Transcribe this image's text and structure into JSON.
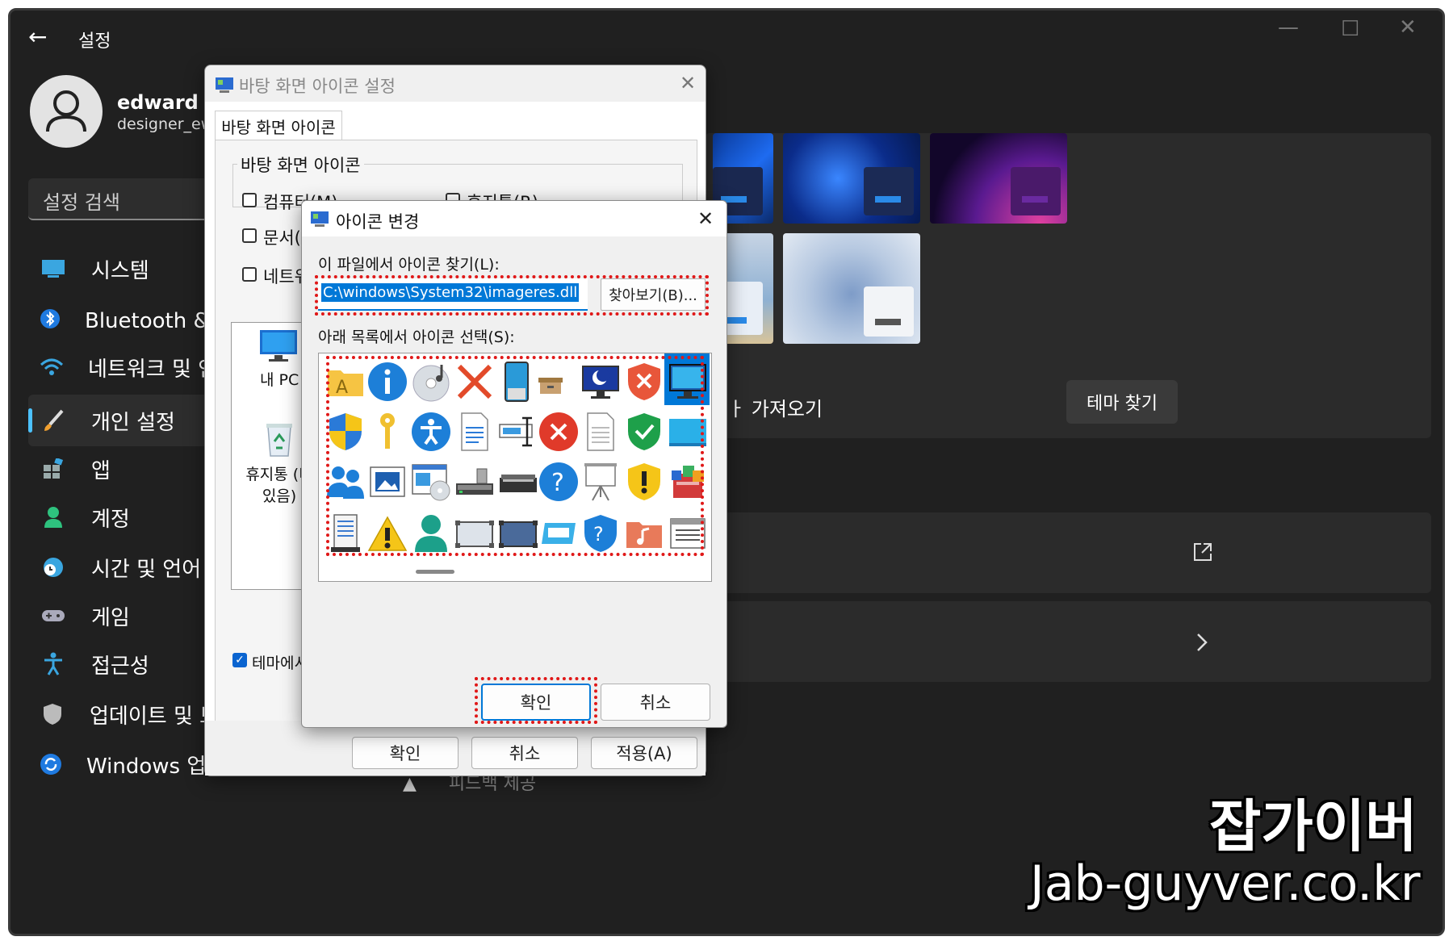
{
  "window": {
    "title": "설정",
    "back": "←",
    "minimize": "—",
    "maximize": "☐",
    "close": "✕"
  },
  "profile": {
    "name": "edward jung",
    "email": "designer_ew@"
  },
  "search": {
    "placeholder": "설정 검색"
  },
  "sidebar": {
    "items": [
      {
        "label": "시스템",
        "icon": "monitor-icon"
      },
      {
        "label": "Bluetooth & 장치",
        "icon": "bluetooth-icon"
      },
      {
        "label": "네트워크 및 인터넷",
        "icon": "wifi-icon"
      },
      {
        "label": "개인 설정",
        "icon": "brush-icon",
        "active": true
      },
      {
        "label": "앱",
        "icon": "apps-icon"
      },
      {
        "label": "계정",
        "icon": "person-icon"
      },
      {
        "label": "시간 및 언어",
        "icon": "clock-globe-icon"
      },
      {
        "label": "게임",
        "icon": "gamepad-icon"
      },
      {
        "label": "접근성",
        "icon": "accessibility-icon"
      },
      {
        "label": "업데이트 및 보안",
        "icon": "shield-icon"
      },
      {
        "label": "Windows 업데이트",
        "icon": "update-icon"
      }
    ]
  },
  "main": {
    "import_theme": "가져오기",
    "import_prefix": "ㅏ",
    "find_theme": "테마 찾기",
    "bottom_partial": "피드백 제공"
  },
  "desktop_dialog": {
    "title": "바탕 화면 아이콘 설정",
    "tab": "바탕 화면 아이콘",
    "group": "바탕 화면 아이콘",
    "checkboxes": [
      "컴퓨터(M)",
      "휴지통(R)",
      "문서(U)",
      "네트워크"
    ],
    "icons": [
      {
        "label": "내 PC"
      },
      {
        "label": "휴지통 (비어 있음)"
      }
    ],
    "recycle_line1": "휴지통 (비",
    "recycle_line2": "있음)",
    "theme_checkbox": "테마에서",
    "ok": "확인",
    "cancel": "취소",
    "apply": "적용(A)"
  },
  "change_dialog": {
    "title": "아이콘 변경",
    "file_label": "이 파일에서 아이콘 찾기(L):",
    "file_value": "C:\\windows\\System32\\imageres.dll",
    "browse": "찾아보기(B)...",
    "list_label": "아래 목록에서 아이콘 선택(S):",
    "ok": "확인",
    "cancel": "취소"
  },
  "watermark": {
    "brand": "잡가이버",
    "url": "Jab-guyver.co.kr"
  },
  "colors": {
    "accent": "#4cc2ff",
    "highlight": "#e01818",
    "selection": "#0078d7"
  }
}
